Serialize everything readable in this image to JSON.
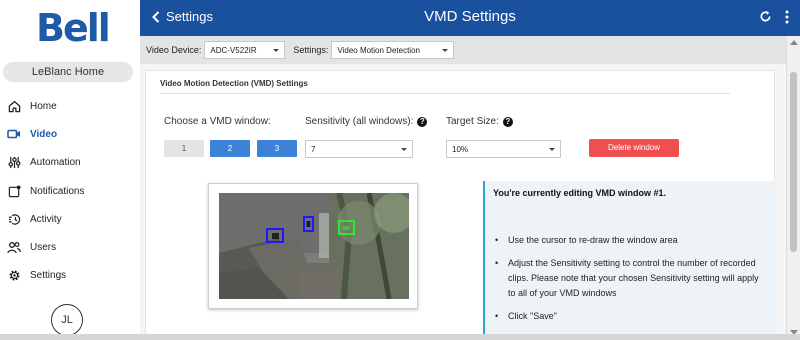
{
  "brand": {
    "logo_text": "Bell",
    "color": "#1f5aa6"
  },
  "sidebar": {
    "location": "LeBlanc Home",
    "items": [
      {
        "label": "Home",
        "icon": "home-icon",
        "active": false
      },
      {
        "label": "Video",
        "icon": "video-camera-icon",
        "active": true
      },
      {
        "label": "Automation",
        "icon": "sliders-icon",
        "active": false
      },
      {
        "label": "Notifications",
        "icon": "notification-icon",
        "active": false
      },
      {
        "label": "Activity",
        "icon": "activity-icon",
        "active": false
      },
      {
        "label": "Users",
        "icon": "users-icon",
        "active": false
      },
      {
        "label": "Settings",
        "icon": "gear-icon",
        "active": false
      }
    ],
    "user_initials": "JL"
  },
  "header": {
    "back_label": "Settings",
    "title": "VMD Settings",
    "icons": [
      "refresh-icon",
      "more-vertical-icon"
    ],
    "color": "#19519e"
  },
  "toolbar": {
    "device_label": "Video Device:",
    "device_value": "ADC-V522IR",
    "settings_label": "Settings:",
    "settings_value": "Video Motion Detection"
  },
  "vmd": {
    "section_title": "Video Motion Detection (VMD) Settings",
    "choose_label": "Choose a VMD window:",
    "windows": [
      {
        "label": "1",
        "selected": false
      },
      {
        "label": "2",
        "selected": true
      },
      {
        "label": "3",
        "selected": true
      }
    ],
    "sensitivity_label": "Sensitivity (all windows):",
    "sensitivity_value": "7",
    "target_label": "Target Size:",
    "target_value": "10%",
    "delete_label": "Delete window",
    "delete_color": "#ef4f4f",
    "window_colors": {
      "blue": "#1a1aff",
      "green": "#2ee82e"
    }
  },
  "info": {
    "title": "You're currently editing VMD window #1.",
    "bullets": [
      "Use the cursor to re-draw the window area",
      "Adjust the Sensitivity setting to control the number of recorded clips. Please note that your chosen Sensitivity setting will apply to all of your VMD windows",
      "Click \"Save\""
    ],
    "accent": "#2aa6c9"
  }
}
